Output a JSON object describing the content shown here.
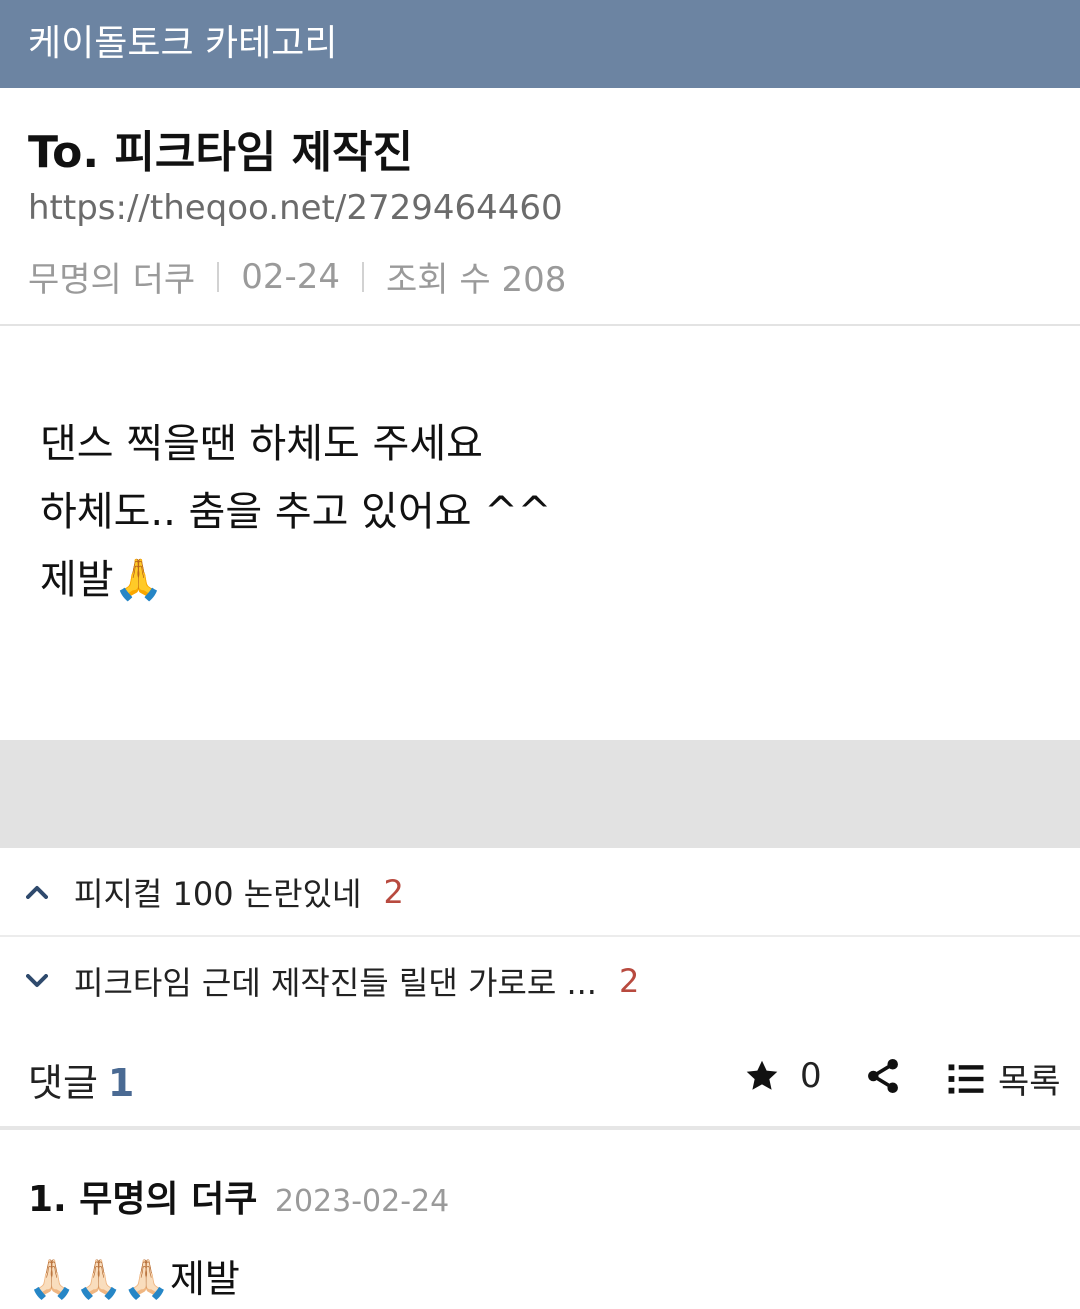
{
  "topbar": {
    "title": "케이돌토크 카테고리"
  },
  "post": {
    "title": "To. 피크타임 제작진",
    "url": "https://theqoo.net/2729464460",
    "author": "무명의 더쿠",
    "date": "02-24",
    "views": "조회 수 208",
    "body_lines": [
      "댄스 찍을땐 하체도 주세요",
      "하체도.. 춤을 추고 있어요 ^^",
      "제발"
    ],
    "body_emoji": "🙏"
  },
  "nav": {
    "prev": {
      "title": "피지컬 100 논란있네",
      "count": "2"
    },
    "next": {
      "title": "피크타임 근데 제작진들 릴댄 가로로 ...",
      "count": "2"
    }
  },
  "actions": {
    "comment_label": "댓글",
    "comment_count": "1",
    "star_count": "0",
    "list_label": "목록"
  },
  "comments": [
    {
      "author": "1. 무명의 더쿠",
      "date": "2023-02-24",
      "emoji": "🙏🏻🙏🏻🙏🏻",
      "text": "제발"
    }
  ],
  "colors": {
    "topbar": "#6c84a2",
    "accent": "#4a6a93",
    "count_red": "#b84a3f"
  }
}
